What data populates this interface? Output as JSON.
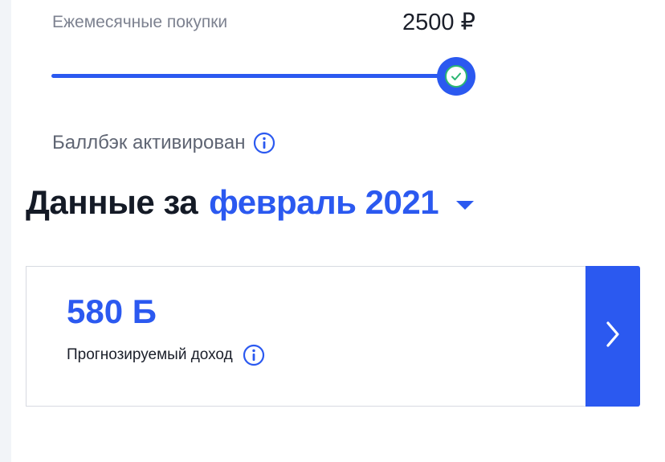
{
  "slider": {
    "label": "Ежемесячные покупки",
    "value": "2500 ₽",
    "fill_fraction": 1.0
  },
  "status": {
    "text": "Баллбэк активирован",
    "info_icon": "info-icon"
  },
  "heading": {
    "static": "Данные за",
    "period": "февраль 2021",
    "dropdown_icon": "caret-down-icon"
  },
  "card": {
    "amount": "580 Б",
    "label": "Прогнозируемый доход",
    "info_icon": "info-icon",
    "arrow_icon": "chevron-right-icon"
  },
  "colors": {
    "accent": "#2b59f0",
    "success": "#2bb673",
    "text_dark": "#141a26",
    "text_muted": "#7d8290"
  }
}
